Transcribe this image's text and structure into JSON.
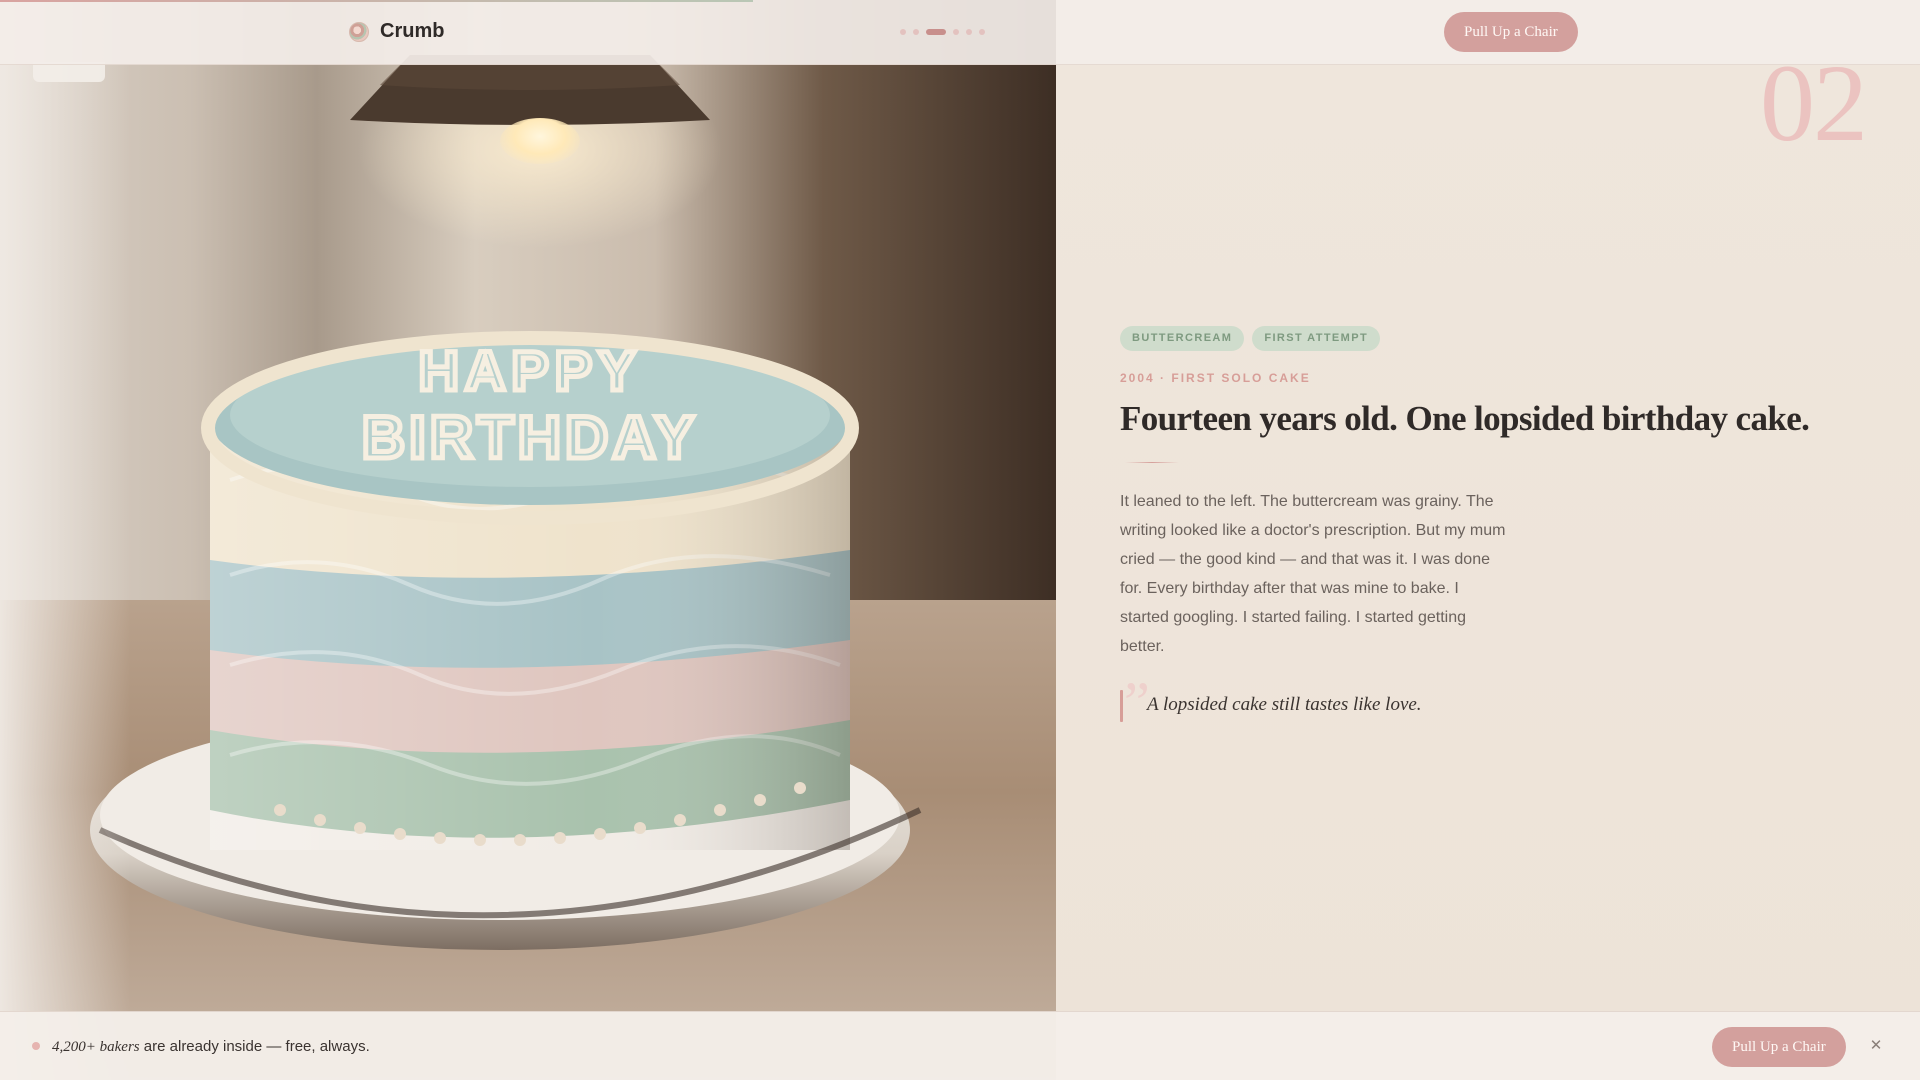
{
  "header": {
    "brand_name": "Crumb",
    "cta_label": "Pull Up a Chair",
    "slide_count": 6,
    "active_slide_index": 2
  },
  "photo": {
    "alt_content": "Pastel layered buttercream cake with HAPPY BIRTHDAY piping",
    "piped_text": "HAPPY BIRTHDAY"
  },
  "slide": {
    "number": "02",
    "tags": [
      "BUTTERCREAM",
      "FIRST ATTEMPT"
    ],
    "eyebrow": "2004 · FIRST SOLO CAKE",
    "headline": "Fourteen years old. One lopsided birthday cake.",
    "body": "It leaned to the left. The buttercream was grainy. The writing looked like a doctor's prescription. But my mum cried — the good kind — and that was it. I was done for. Every birthday after that was mine to bake. I started googling. I started failing. I started getting better.",
    "quote_mark": "”",
    "quote": "A lopsided cake still tastes like love."
  },
  "bottom_bar": {
    "count_text": "4,200+ bakers",
    "rest_text": " are already inside — free, always.",
    "cta_label": "Pull Up a Chair",
    "close_symbol": "✕"
  },
  "colors": {
    "accent": "#d3a09d",
    "tag_bg": "#cfdccc",
    "tag_text": "#7e9a80",
    "eyebrow": "#d79e98",
    "slide_number": "#ebc3c0",
    "panel_bg": "#efe6dc"
  }
}
